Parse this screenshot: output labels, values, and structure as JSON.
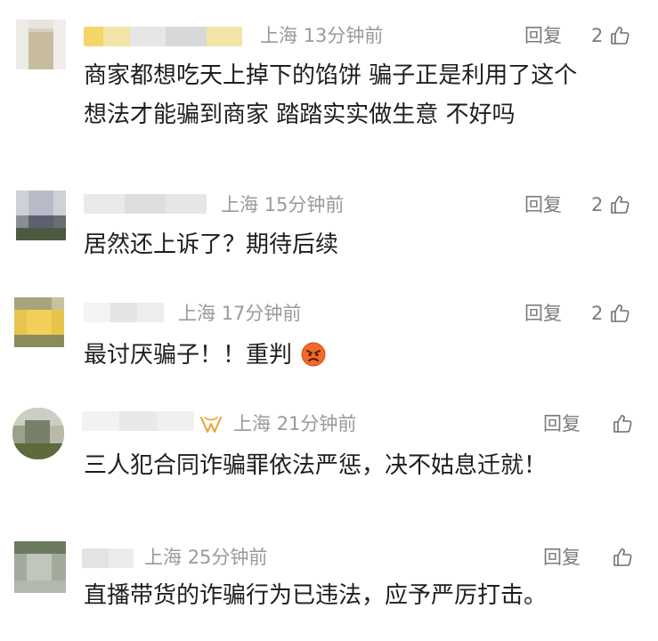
{
  "comments": [
    {
      "location": "上海",
      "time": "13分钟前",
      "reply_label": "回复",
      "likes": "2",
      "text_lines": [
        "商家都想吃天上掉下的馅饼 骗子正是利用了这个",
        "想法才能骗到商家 踏踏实实做生意 不好吗"
      ]
    },
    {
      "location": "上海",
      "time": "15分钟前",
      "reply_label": "回复",
      "likes": "2",
      "text_lines": [
        "居然还上诉了？期待后续"
      ]
    },
    {
      "location": "上海",
      "time": "17分钟前",
      "reply_label": "回复",
      "likes": "2",
      "text_lines": [
        "最讨厌骗子！！重判"
      ],
      "emoji": "angry-face"
    },
    {
      "location": "上海",
      "time": "21分钟前",
      "reply_label": "回复",
      "likes": "",
      "text_lines": [
        "三人犯合同诈骗罪依法严惩，决不姑息迁就！"
      ],
      "badge": "orange-v-badge"
    },
    {
      "location": "上海",
      "time": "25分钟前",
      "reply_label": "回复",
      "likes": "",
      "text_lines": [
        "直播带货的诈骗行为已违法，应予严厉打击。"
      ]
    }
  ],
  "colors": {
    "meta": "#9a9a9a",
    "reply": "#7b7b7b",
    "text": "#1e1e1e",
    "badge": "#f0a030"
  }
}
